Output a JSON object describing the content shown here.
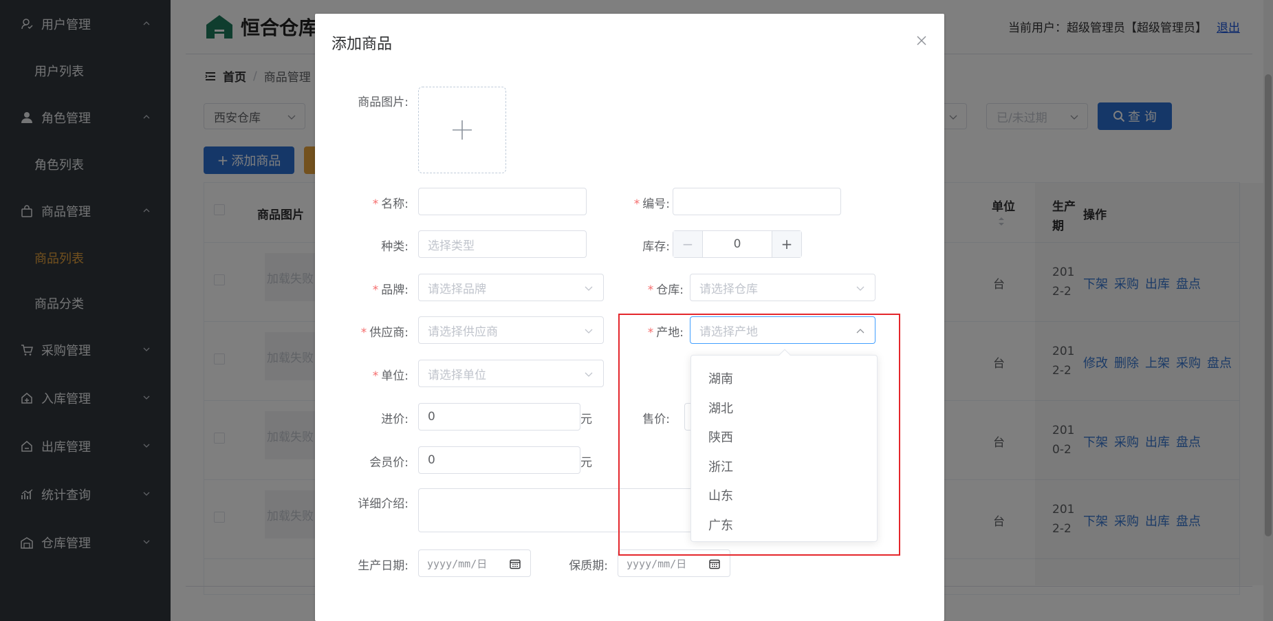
{
  "sidebar": {
    "groups": [
      {
        "label": "用户管理",
        "icon": "user-manage-icon",
        "expanded": true,
        "items": [
          "用户列表"
        ]
      },
      {
        "label": "角色管理",
        "icon": "role-icon",
        "expanded": true,
        "items": [
          "角色列表"
        ]
      },
      {
        "label": "商品管理",
        "icon": "bag-icon",
        "expanded": true,
        "items": [
          "商品列表",
          "商品分类"
        ]
      },
      {
        "label": "采购管理",
        "icon": "cart-icon",
        "expanded": false,
        "items": []
      },
      {
        "label": "入库管理",
        "icon": "inbound-icon",
        "expanded": false,
        "items": []
      },
      {
        "label": "出库管理",
        "icon": "outbound-icon",
        "expanded": false,
        "items": []
      },
      {
        "label": "统计查询",
        "icon": "chart-icon",
        "expanded": false,
        "items": []
      },
      {
        "label": "仓库管理",
        "icon": "warehouse-icon",
        "expanded": false,
        "items": []
      }
    ],
    "active_item": "商品列表"
  },
  "header": {
    "logo_text": "恒合仓库",
    "current_user_label": "当前用户：超级管理员【超级管理员】",
    "logout_label": "退出"
  },
  "breadcrumb": {
    "home": "首页",
    "current": "商品管理"
  },
  "filters": {
    "warehouse_value": "西安仓库",
    "expiry_placeholder": "已/未过期",
    "search_label": "查 询"
  },
  "toolbar": {
    "add_label": "添加商品"
  },
  "table": {
    "headers": [
      "商品图片",
      "单位",
      "生产日期",
      "操作"
    ],
    "header_fragments": {
      "unit": "单位",
      "prod_date_1": "生产",
      "prod_date_2": "期"
    },
    "rows": [
      {
        "image": "加载失败",
        "unit": "台",
        "date_1": "201",
        "date_2": "2-2",
        "ops": [
          "下架",
          "采购",
          "出库",
          "盘点"
        ]
      },
      {
        "image": "加载失败",
        "unit": "台",
        "date_1": "201",
        "date_2": "2-2",
        "ops": [
          "修改",
          "删除",
          "上架",
          "采购",
          "盘点"
        ]
      },
      {
        "image": "加载失败",
        "unit": "台",
        "date_1": "201",
        "date_2": "0-2",
        "ops": [
          "下架",
          "采购",
          "出库",
          "盘点"
        ]
      },
      {
        "image": "加载失败",
        "unit": "台",
        "date_1": "201",
        "date_2": "2-2",
        "ops": [
          "下架",
          "采购",
          "出库",
          "盘点"
        ]
      }
    ]
  },
  "dialog": {
    "title": "添加商品",
    "labels": {
      "image": "商品图片:",
      "name": "名称:",
      "code": "编号:",
      "category": "种类:",
      "stock": "库存:",
      "brand": "品牌:",
      "warehouse": "仓库:",
      "supplier": "供应商:",
      "origin": "产地:",
      "unit": "单位:",
      "purchase_price": "进价:",
      "sale_price": "售价:",
      "member_price": "会员价:",
      "description": "详细介绍:",
      "production_date": "生产日期:",
      "shelf_life": "保质期:"
    },
    "placeholders": {
      "category": "选择类型",
      "brand": "请选择品牌",
      "warehouse": "请选择仓库",
      "supplier": "请选择供应商",
      "origin": "请选择产地",
      "unit": "请选择单位",
      "date": "yyyy/mm/日"
    },
    "values": {
      "stock": "0",
      "purchase_price": "0",
      "member_price": "0"
    },
    "currency_unit": "元",
    "required_mark": "*",
    "origin_options": [
      "湖南",
      "湖北",
      "陕西",
      "浙江",
      "山东",
      "广东"
    ]
  },
  "colors": {
    "sidebar_bg": "#30363d",
    "active_menu": "#e6a23c",
    "primary": "#2a6fd1",
    "required": "#f56c6c",
    "highlight": "#e4262b"
  }
}
